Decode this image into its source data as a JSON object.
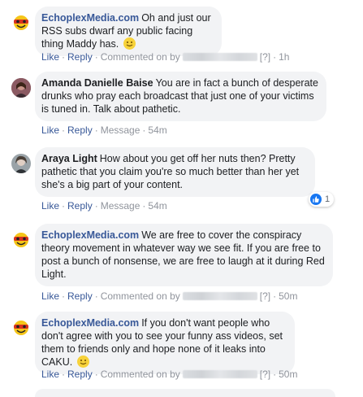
{
  "comments": [
    {
      "author": "EchoplexMedia.com",
      "text": "Oh and just our RSS subs dwarf any public facing thing Maddy has.",
      "has_emoji": true,
      "actions": {
        "like": "Like",
        "reply": "Reply",
        "meta": "Commented on by",
        "tag": "[?]",
        "time": "1h"
      }
    },
    {
      "author": "Amanda Danielle Baise",
      "text": "You are in fact a bunch of desperate drunks who pray each broadcast that just one of your victims is tuned in. Talk about pathetic.",
      "actions": {
        "like": "Like",
        "reply": "Reply",
        "meta": "Message",
        "time": "54m"
      }
    },
    {
      "author": "Araya Light",
      "text": "How about you get off her nuts then? Pretty pathetic that you claim you're so much better than her yet she's a big part of your content.",
      "reaction_count": "1",
      "actions": {
        "like": "Like",
        "reply": "Reply",
        "meta": "Message",
        "time": "54m"
      }
    },
    {
      "author": "EchoplexMedia.com",
      "text": "We are free to cover the conspiracy theory movement in whatever way we see fit. If you are free to post a bunch of nonsense, we are free to laugh at it during Red Light.",
      "actions": {
        "like": "Like",
        "reply": "Reply",
        "meta": "Commented on by",
        "tag": "[?]",
        "time": "50m"
      }
    },
    {
      "author": "EchoplexMedia.com",
      "text": "If you don't want people who don't agree with you to see your funny ass videos, set them to friends only and hope none of it leaks into CAKU.",
      "has_emoji": true,
      "actions": {
        "like": "Like",
        "reply": "Reply",
        "meta": "Commented on by",
        "tag": "[?]",
        "time": "50m"
      }
    }
  ],
  "colors": {
    "link": "#385898",
    "bubble": "#f2f3f5",
    "meta": "#90949c",
    "like_badge": "#1877f2"
  }
}
